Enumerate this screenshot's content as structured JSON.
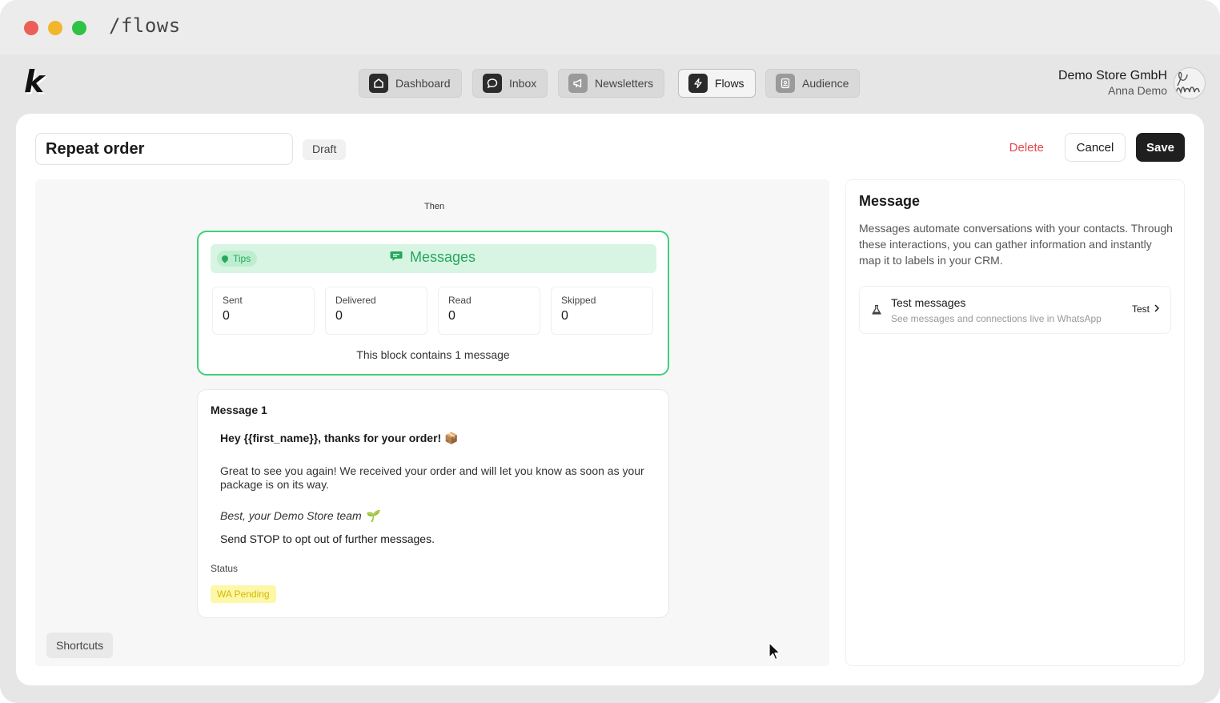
{
  "window": {
    "url": "/flows"
  },
  "nav": {
    "logo": "k",
    "items": [
      {
        "label": "Dashboard",
        "icon": "home-icon",
        "active": false
      },
      {
        "label": "Inbox",
        "icon": "chat-icon",
        "active": false
      },
      {
        "label": "Newsletters",
        "icon": "megaphone-icon",
        "active": false
      },
      {
        "label": "Flows",
        "icon": "lightning-icon",
        "active": true
      },
      {
        "label": "Audience",
        "icon": "contacts-icon",
        "active": false
      }
    ],
    "store_name": "Demo Store GmbH",
    "user_name": "Anna Demo"
  },
  "header": {
    "flow_name": "Repeat order",
    "status": "Draft",
    "delete_label": "Delete",
    "cancel_label": "Cancel",
    "save_label": "Save"
  },
  "canvas": {
    "then_label": "Then",
    "block": {
      "tips_label": "Tips",
      "title": "Messages",
      "stats": [
        {
          "label": "Sent",
          "value": "0"
        },
        {
          "label": "Delivered",
          "value": "0"
        },
        {
          "label": "Read",
          "value": "0"
        },
        {
          "label": "Skipped",
          "value": "0"
        }
      ],
      "note": "This block contains 1 message"
    },
    "message": {
      "title": "Message 1",
      "greeting": "Hey {{first_name}}, thanks for your order! 📦",
      "body": "Great to see you again! We received your order and will let you know as soon as your package is on its way.",
      "signature": "Best, your Demo Store team 🌱",
      "optout": "Send STOP to opt out of further messages.",
      "status_label": "Status",
      "status_value": "WA Pending"
    },
    "shortcuts_label": "Shortcuts"
  },
  "sidebar": {
    "title": "Message",
    "description": "Messages automate conversations with your contacts. Through these interactions, you can gather information and instantly map it to labels in your CRM.",
    "test": {
      "title": "Test messages",
      "subtitle": "See messages and connections live in WhatsApp",
      "button_label": "Test"
    }
  },
  "colors": {
    "accent_green": "#27a85d",
    "block_border": "#3fd07a",
    "delete_red": "#e5484d",
    "pending_yellow": "#fdf7a8"
  }
}
